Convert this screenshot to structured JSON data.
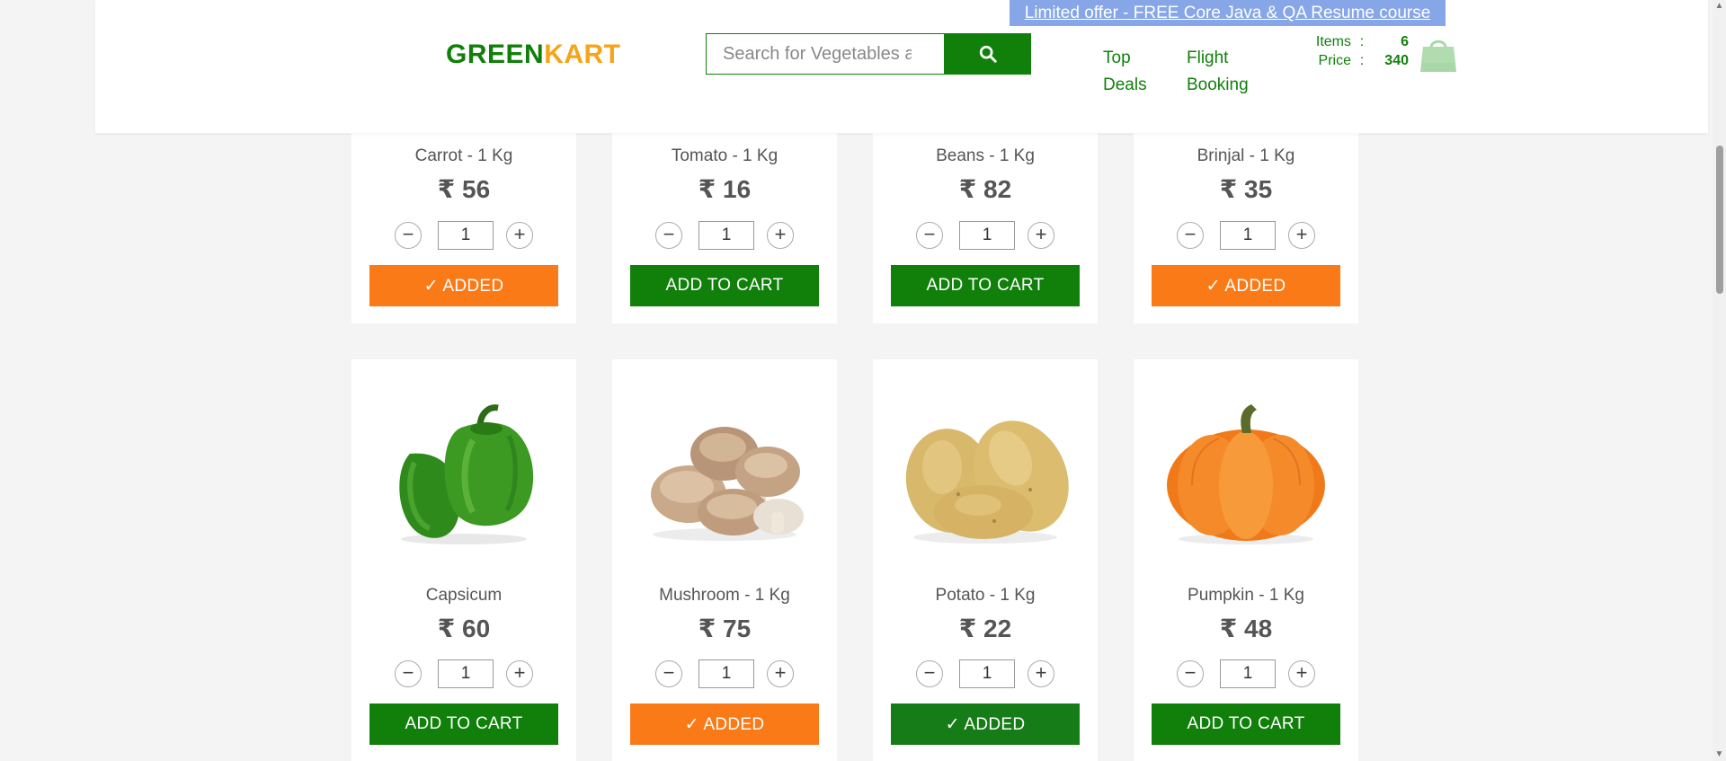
{
  "header": {
    "brand_green": "GREEN",
    "brand_orange": "KART",
    "search_placeholder": "Search for Vegetables and Fruits",
    "offer_text": "Limited offer - FREE Core Java & QA Resume course",
    "nav_top": "Top Deals",
    "nav_flight": "Flight Booking",
    "cart": {
      "items_label": "Items",
      "items_value": "6",
      "price_label": "Price",
      "price_value": "340",
      "separator": ":"
    }
  },
  "products": [
    {
      "name": "Carrot - 1 Kg",
      "price": "₹ 56",
      "qty": "1",
      "button": "✓ ADDED",
      "state": "added-orange",
      "icon": "carrot-image"
    },
    {
      "name": "Tomato - 1 Kg",
      "price": "₹ 16",
      "qty": "1",
      "button": "ADD TO CART",
      "state": "add",
      "icon": "tomato-image"
    },
    {
      "name": "Beans - 1 Kg",
      "price": "₹ 82",
      "qty": "1",
      "button": "ADD TO CART",
      "state": "add",
      "icon": "beans-image"
    },
    {
      "name": "Brinjal - 1 Kg",
      "price": "₹ 35",
      "qty": "1",
      "button": "✓ ADDED",
      "state": "added-orange",
      "icon": "brinjal-image"
    },
    {
      "name": "Capsicum",
      "price": "₹ 60",
      "qty": "1",
      "button": "ADD TO CART",
      "state": "add",
      "icon": "capsicum-image"
    },
    {
      "name": "Mushroom - 1 Kg",
      "price": "₹ 75",
      "qty": "1",
      "button": "✓ ADDED",
      "state": "added-orange",
      "icon": "mushroom-image"
    },
    {
      "name": "Potato - 1 Kg",
      "price": "₹ 22",
      "qty": "1",
      "button": "✓ ADDED",
      "state": "added-green",
      "icon": "potato-image"
    },
    {
      "name": "Pumpkin - 1 Kg",
      "price": "₹ 48",
      "qty": "1",
      "button": "ADD TO CART",
      "state": "add",
      "icon": "pumpkin-image"
    }
  ],
  "stepper": {
    "minus": "−",
    "plus": "+"
  },
  "colors": {
    "brand_green": "#10800a",
    "brand_orange": "#f7a416",
    "added_orange": "#fa7a17",
    "offer_blue": "#86a6e8"
  }
}
